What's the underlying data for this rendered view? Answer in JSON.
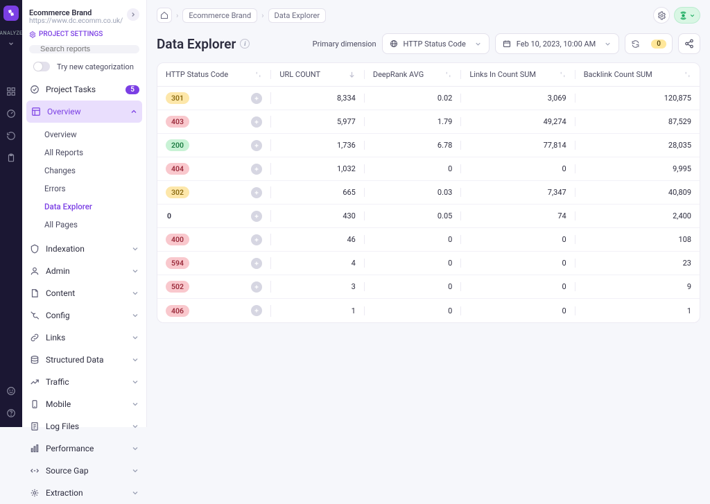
{
  "iconrail": {
    "analyze_label": "ANALYZE"
  },
  "project": {
    "name": "Ecommerce Brand",
    "url": "https://www.dc.ecomm.co.uk/",
    "settings_label": "PROJECT SETTINGS"
  },
  "search": {
    "placeholder": "Search reports"
  },
  "try_toggle": {
    "label": "Try new categorization"
  },
  "tasks": {
    "label": "Project Tasks",
    "count": "5"
  },
  "overview": {
    "label": "Overview",
    "items": [
      {
        "label": "Overview"
      },
      {
        "label": "All Reports"
      },
      {
        "label": "Changes"
      },
      {
        "label": "Errors"
      },
      {
        "label": "Data Explorer",
        "current": true
      },
      {
        "label": "All Pages"
      }
    ]
  },
  "nav": [
    {
      "label": "Indexation"
    },
    {
      "label": "Admin"
    },
    {
      "label": "Content"
    },
    {
      "label": "Config"
    },
    {
      "label": "Links"
    },
    {
      "label": "Structured Data"
    },
    {
      "label": "Traffic"
    },
    {
      "label": "Mobile"
    },
    {
      "label": "Log Files"
    },
    {
      "label": "Performance"
    },
    {
      "label": "Source Gap"
    },
    {
      "label": "Extraction"
    }
  ],
  "breadcrumbs": {
    "item1": "Ecommerce Brand",
    "item2": "Data Explorer"
  },
  "page_title": "Data Explorer",
  "primary_dimension": {
    "label": "Primary dimension",
    "value": "HTTP Status Code"
  },
  "date": {
    "value": "Feb 10, 2023, 10:00 AM"
  },
  "refresh": {
    "count": "0"
  },
  "columns": {
    "c1": "HTTP Status Code",
    "c2": "URL COUNT",
    "c3": "DeepRank AVG",
    "c4": "Links In Count SUM",
    "c5": "Backlink Count SUM"
  },
  "rows": [
    {
      "code": "301",
      "tone": "yellow",
      "url_count": "8,334",
      "deeprank": "0.02",
      "links_in": "3,069",
      "backlinks": "120,875"
    },
    {
      "code": "403",
      "tone": "red",
      "url_count": "5,977",
      "deeprank": "1.79",
      "links_in": "49,274",
      "backlinks": "87,529"
    },
    {
      "code": "200",
      "tone": "green",
      "url_count": "1,736",
      "deeprank": "6.78",
      "links_in": "77,814",
      "backlinks": "28,035"
    },
    {
      "code": "404",
      "tone": "red",
      "url_count": "1,032",
      "deeprank": "0",
      "links_in": "0",
      "backlinks": "9,995"
    },
    {
      "code": "302",
      "tone": "yellow",
      "url_count": "665",
      "deeprank": "0.03",
      "links_in": "7,347",
      "backlinks": "40,809"
    },
    {
      "code": "0",
      "tone": "gray",
      "url_count": "430",
      "deeprank": "0.05",
      "links_in": "74",
      "backlinks": "2,400"
    },
    {
      "code": "400",
      "tone": "red",
      "url_count": "46",
      "deeprank": "0",
      "links_in": "0",
      "backlinks": "108"
    },
    {
      "code": "594",
      "tone": "red",
      "url_count": "4",
      "deeprank": "0",
      "links_in": "0",
      "backlinks": "23"
    },
    {
      "code": "502",
      "tone": "red",
      "url_count": "3",
      "deeprank": "0",
      "links_in": "0",
      "backlinks": "9"
    },
    {
      "code": "406",
      "tone": "red",
      "url_count": "1",
      "deeprank": "0",
      "links_in": "0",
      "backlinks": "1"
    }
  ]
}
